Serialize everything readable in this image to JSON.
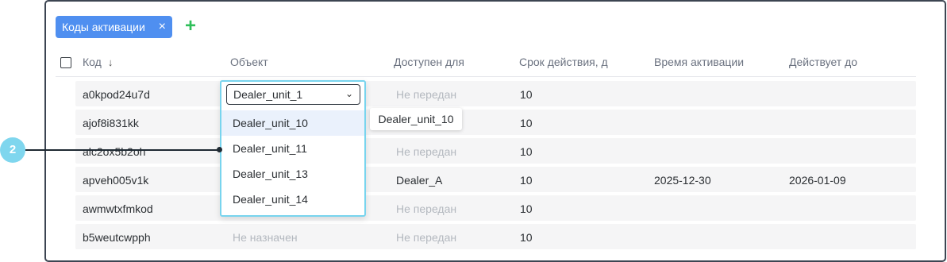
{
  "filter_chip": {
    "label": "Коды активации",
    "close_icon": "×"
  },
  "add_icon": "+",
  "columns": {
    "code": "Код",
    "sort_icon": "↓",
    "object": "Объект",
    "available_for": "Доступен для",
    "validity": "Срок действия, д",
    "activation_time": "Время активации",
    "valid_until": "Действует до"
  },
  "rows": [
    {
      "code": "a0kpod24u7d",
      "object": "",
      "available_for": "Не передан",
      "validity": "10",
      "activation_time": "",
      "valid_until": ""
    },
    {
      "code": "ajof8i831kk",
      "object": "",
      "available_for": "",
      "validity": "10",
      "activation_time": "",
      "valid_until": ""
    },
    {
      "code": "alc2ox5b2oh",
      "object": "",
      "available_for": "Не передан",
      "validity": "10",
      "activation_time": "",
      "valid_until": ""
    },
    {
      "code": "apveh005v1k",
      "object": "",
      "available_for": "Dealer_A",
      "validity": "10",
      "activation_time": "2025-12-30",
      "valid_until": "2026-01-09"
    },
    {
      "code": "awmwtxfmkod",
      "object": "",
      "available_for": "Не передан",
      "validity": "10",
      "activation_time": "",
      "valid_until": ""
    },
    {
      "code": "b5weutcwpph",
      "object": "Не назначен",
      "available_for": "Не передан",
      "validity": "10",
      "activation_time": "",
      "valid_until": ""
    }
  ],
  "object_select": {
    "value": "Dealer_unit_1",
    "caret_icon": "⌄",
    "options": [
      "Dealer_unit_10",
      "Dealer_unit_11",
      "Dealer_unit_13",
      "Dealer_unit_14"
    ]
  },
  "tooltip": "Dealer_unit_10",
  "step_marker": "2",
  "colors": {
    "chip": "#4f8ff0",
    "add": "#2fbf5a",
    "focus": "#78d4ee",
    "marker": "#7fd6ee"
  }
}
